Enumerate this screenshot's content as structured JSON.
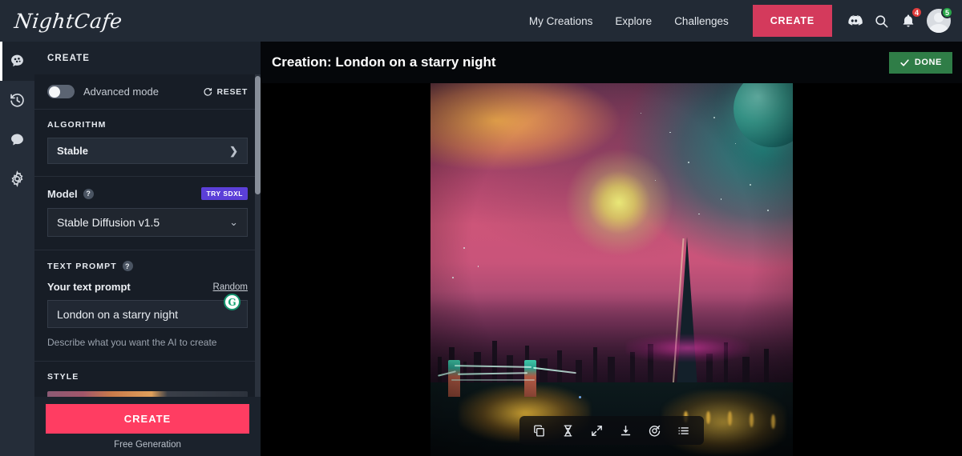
{
  "brand": {
    "name": "NightCafe"
  },
  "topnav": {
    "links": [
      {
        "label": "My Creations",
        "icon": "none"
      },
      {
        "label": "Explore",
        "icon": "none"
      },
      {
        "label": "Challenges",
        "icon": "none"
      }
    ],
    "create_label": "CREATE",
    "create_color": "#d43a5c",
    "icons": [
      {
        "name": "discord-icon"
      },
      {
        "name": "search-icon"
      },
      {
        "name": "bell-icon",
        "badge": "4",
        "badge_color": "#e03d3d"
      },
      {
        "name": "avatar",
        "badge": "5",
        "badge_color": "#2aa84a"
      }
    ]
  },
  "rail": {
    "items": [
      {
        "name": "create-rail-icon",
        "label": "Create",
        "active": true
      },
      {
        "name": "history-clock-icon",
        "label": "History",
        "active": false
      },
      {
        "name": "chat-bubble-icon",
        "label": "Chat",
        "active": false
      },
      {
        "name": "gear-icon",
        "label": "Settings",
        "active": false
      }
    ]
  },
  "panel": {
    "title": "CREATE",
    "advanced_mode": {
      "label": "Advanced mode",
      "enabled": false
    },
    "reset_label": "RESET",
    "algorithm": {
      "title": "ALGORITHM",
      "value": "Stable"
    },
    "model": {
      "title": "Model",
      "help": "?",
      "badge": "TRY SDXL",
      "badge_color": "#5b3fd8",
      "value": "Stable Diffusion v1.5"
    },
    "text_prompt": {
      "title": "TEXT PROMPT",
      "help": "?",
      "label": "Your text prompt",
      "random_label": "Random",
      "value": "London on a starry night",
      "placeholder": "Describe what you want the AI to create",
      "helper": "Describe what you want the AI to create",
      "grammarly_icon": "G"
    },
    "style": {
      "title": "STYLE"
    },
    "cta": {
      "create_label": "CREATE",
      "create_color": "#ff3d62",
      "free_label": "Free Generation"
    }
  },
  "main": {
    "title": "Creation: London on a starry night",
    "done_label": "DONE",
    "done_color": "#2f7d47",
    "toolbar": [
      {
        "name": "duplicate-icon",
        "label": "Duplicate"
      },
      {
        "name": "evolve-dna-icon",
        "label": "Evolve"
      },
      {
        "name": "fullscreen-icon",
        "label": "Fullscreen"
      },
      {
        "name": "download-icon",
        "label": "Download"
      },
      {
        "name": "target-icon",
        "label": "Enhance"
      },
      {
        "name": "details-list-icon",
        "label": "Details"
      }
    ],
    "artwork": {
      "alt": "London skyline at night with Tower Bridge, pink and teal sky, glowing moon"
    }
  }
}
